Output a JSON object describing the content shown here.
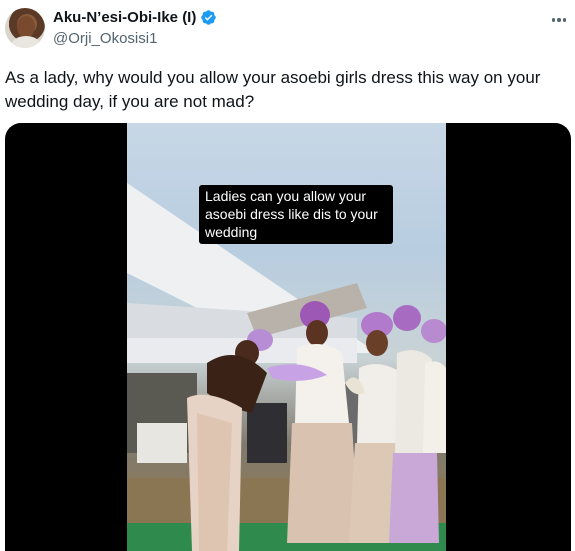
{
  "author": {
    "display_name": "Aku-N’esi-Obi-Ike (I)",
    "handle": "@Orji_Okosisi1",
    "verified": true
  },
  "tweet": {
    "text": "As a lady, why would you allow your asoebi girls dress this way on your wedding day, if you are not mad?"
  },
  "media": {
    "type": "video",
    "caption_lines": [
      "Ladies can you allow your",
      "asoebi dress like dis to your",
      "wedding"
    ]
  },
  "icons": {
    "verified": "verified-badge-icon",
    "more": "more-options-icon"
  },
  "colors": {
    "verified_badge": "#1d9bf0",
    "secondary_text": "#536471",
    "primary_text": "#0f1419"
  }
}
